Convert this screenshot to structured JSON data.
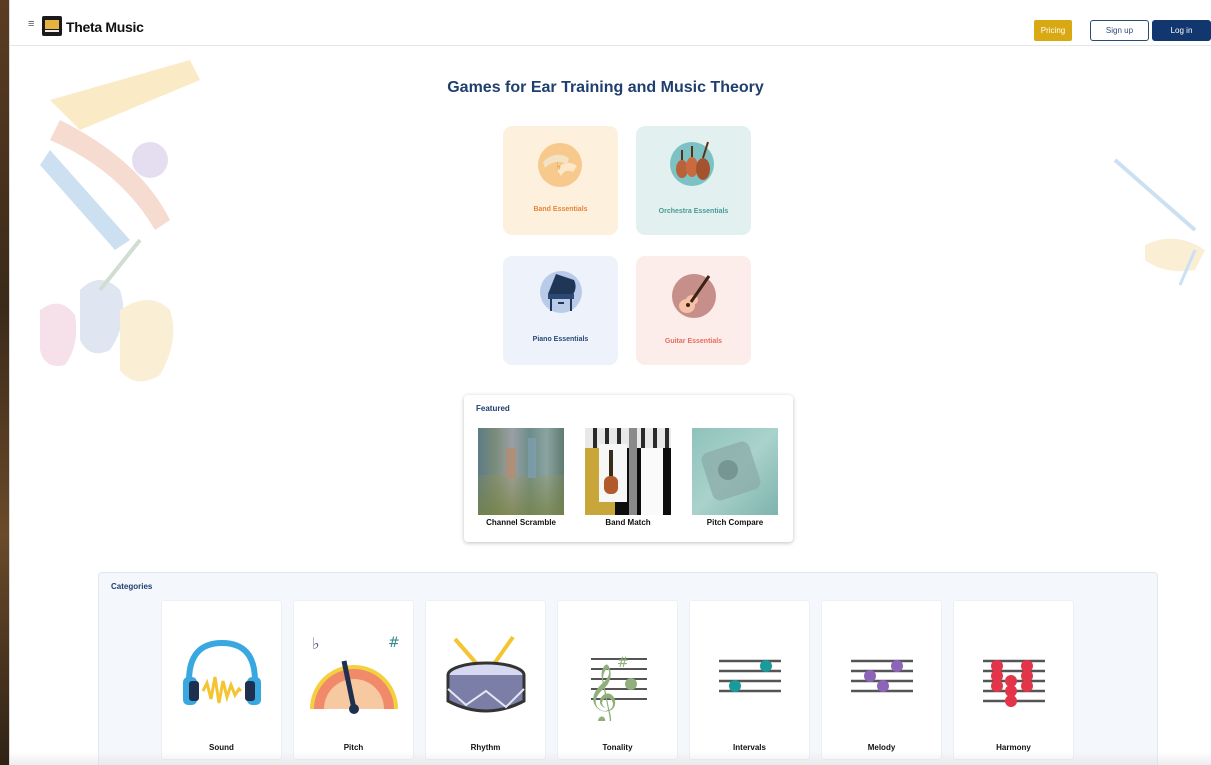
{
  "header": {
    "menu_icon": "≡",
    "brand": "Theta Music",
    "pricing_label": "Pricing",
    "signup_label": "Sign up",
    "login_label": "Log in"
  },
  "main": {
    "title": "Games for Ear Training and Music Theory",
    "essentials": [
      {
        "label": "Band Essentials",
        "color": "#e8843a",
        "bg": "#fdf1de"
      },
      {
        "label": "Orchestra Essentials",
        "color": "#4a9a96",
        "bg": "#e2f1ef"
      },
      {
        "label": "Piano Essentials",
        "color": "#2a4a78",
        "bg": "#eef2fa"
      },
      {
        "label": "Guitar Essentials",
        "color": "#e4705f",
        "bg": "#fcecea"
      }
    ]
  },
  "featured": {
    "title": "Featured",
    "items": [
      {
        "label": "Channel Scramble"
      },
      {
        "label": "Band Match"
      },
      {
        "label": "Pitch Compare"
      }
    ]
  },
  "categories": {
    "title": "Categories",
    "items": [
      {
        "label": "Sound",
        "icon": "headphones-icon"
      },
      {
        "label": "Pitch",
        "icon": "pitch-gauge-icon"
      },
      {
        "label": "Rhythm",
        "icon": "drum-icon"
      },
      {
        "label": "Tonality",
        "icon": "treble-clef-icon"
      },
      {
        "label": "Intervals",
        "icon": "intervals-staff-icon"
      },
      {
        "label": "Melody",
        "icon": "melody-staff-icon"
      },
      {
        "label": "Harmony",
        "icon": "harmony-staff-icon"
      }
    ]
  },
  "colors": {
    "brand_navy": "#12366e",
    "pricing_gold": "#d9a914",
    "title_blue": "#1f3f6e"
  }
}
